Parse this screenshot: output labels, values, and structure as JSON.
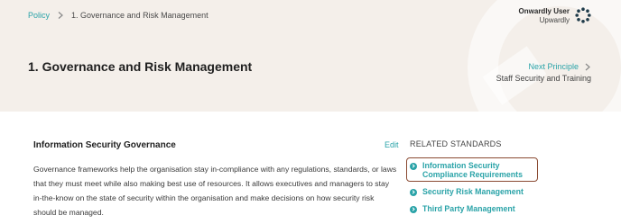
{
  "breadcrumb": {
    "root": "Policy",
    "current": "1. Governance and Risk Management"
  },
  "user": {
    "name": "Onwardly User",
    "org": "Upwardly"
  },
  "page": {
    "title": "1. Governance and Risk Management"
  },
  "next_principle": {
    "label": "Next Principle",
    "target": "Staff Security and Training"
  },
  "section": {
    "title": "Information Security Governance",
    "edit_label": "Edit",
    "text": "Governance frameworks help the organisation stay in-compliance with any regulations, standards, or laws that they must meet while also making best use of resources. It allows executives and managers to stay in-the-know on the state of security within the organisation and make decisions on how security risk should be managed."
  },
  "related": {
    "title": "RELATED STANDARDS",
    "items": [
      {
        "label": "Information Security Compliance Requirements"
      },
      {
        "label": "Security Risk Management"
      },
      {
        "label": "Third Party Management"
      }
    ]
  },
  "colors": {
    "accent": "#2aa3a8",
    "header_bg": "#f4efea",
    "highlight_border": "#8a4a32"
  }
}
